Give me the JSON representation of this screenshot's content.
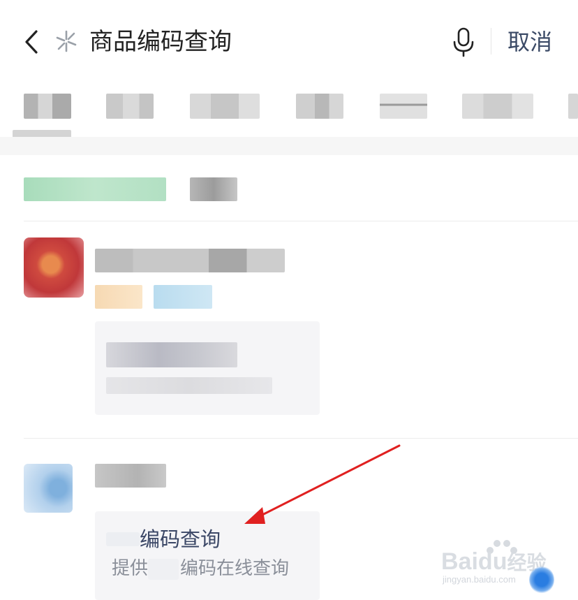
{
  "header": {
    "back_icon": "chevron-left-icon",
    "spark_icon": "sparkle-icon",
    "search_query": "商品编码查询",
    "mic_icon": "microphone-icon",
    "cancel_label": "取消"
  },
  "result": {
    "card_title_suffix": "编码查询",
    "card_desc_prefix": "提供",
    "card_desc_suffix": "编码在线查询"
  },
  "watermark": {
    "brand": "Bai",
    "brand_mid": "du",
    "brand_cn": "经验",
    "url": "jingyan.baidu.com"
  },
  "colors": {
    "accent_text": "#3b4a66",
    "arrow": "#e02020",
    "card_bg": "#f5f5f7"
  }
}
